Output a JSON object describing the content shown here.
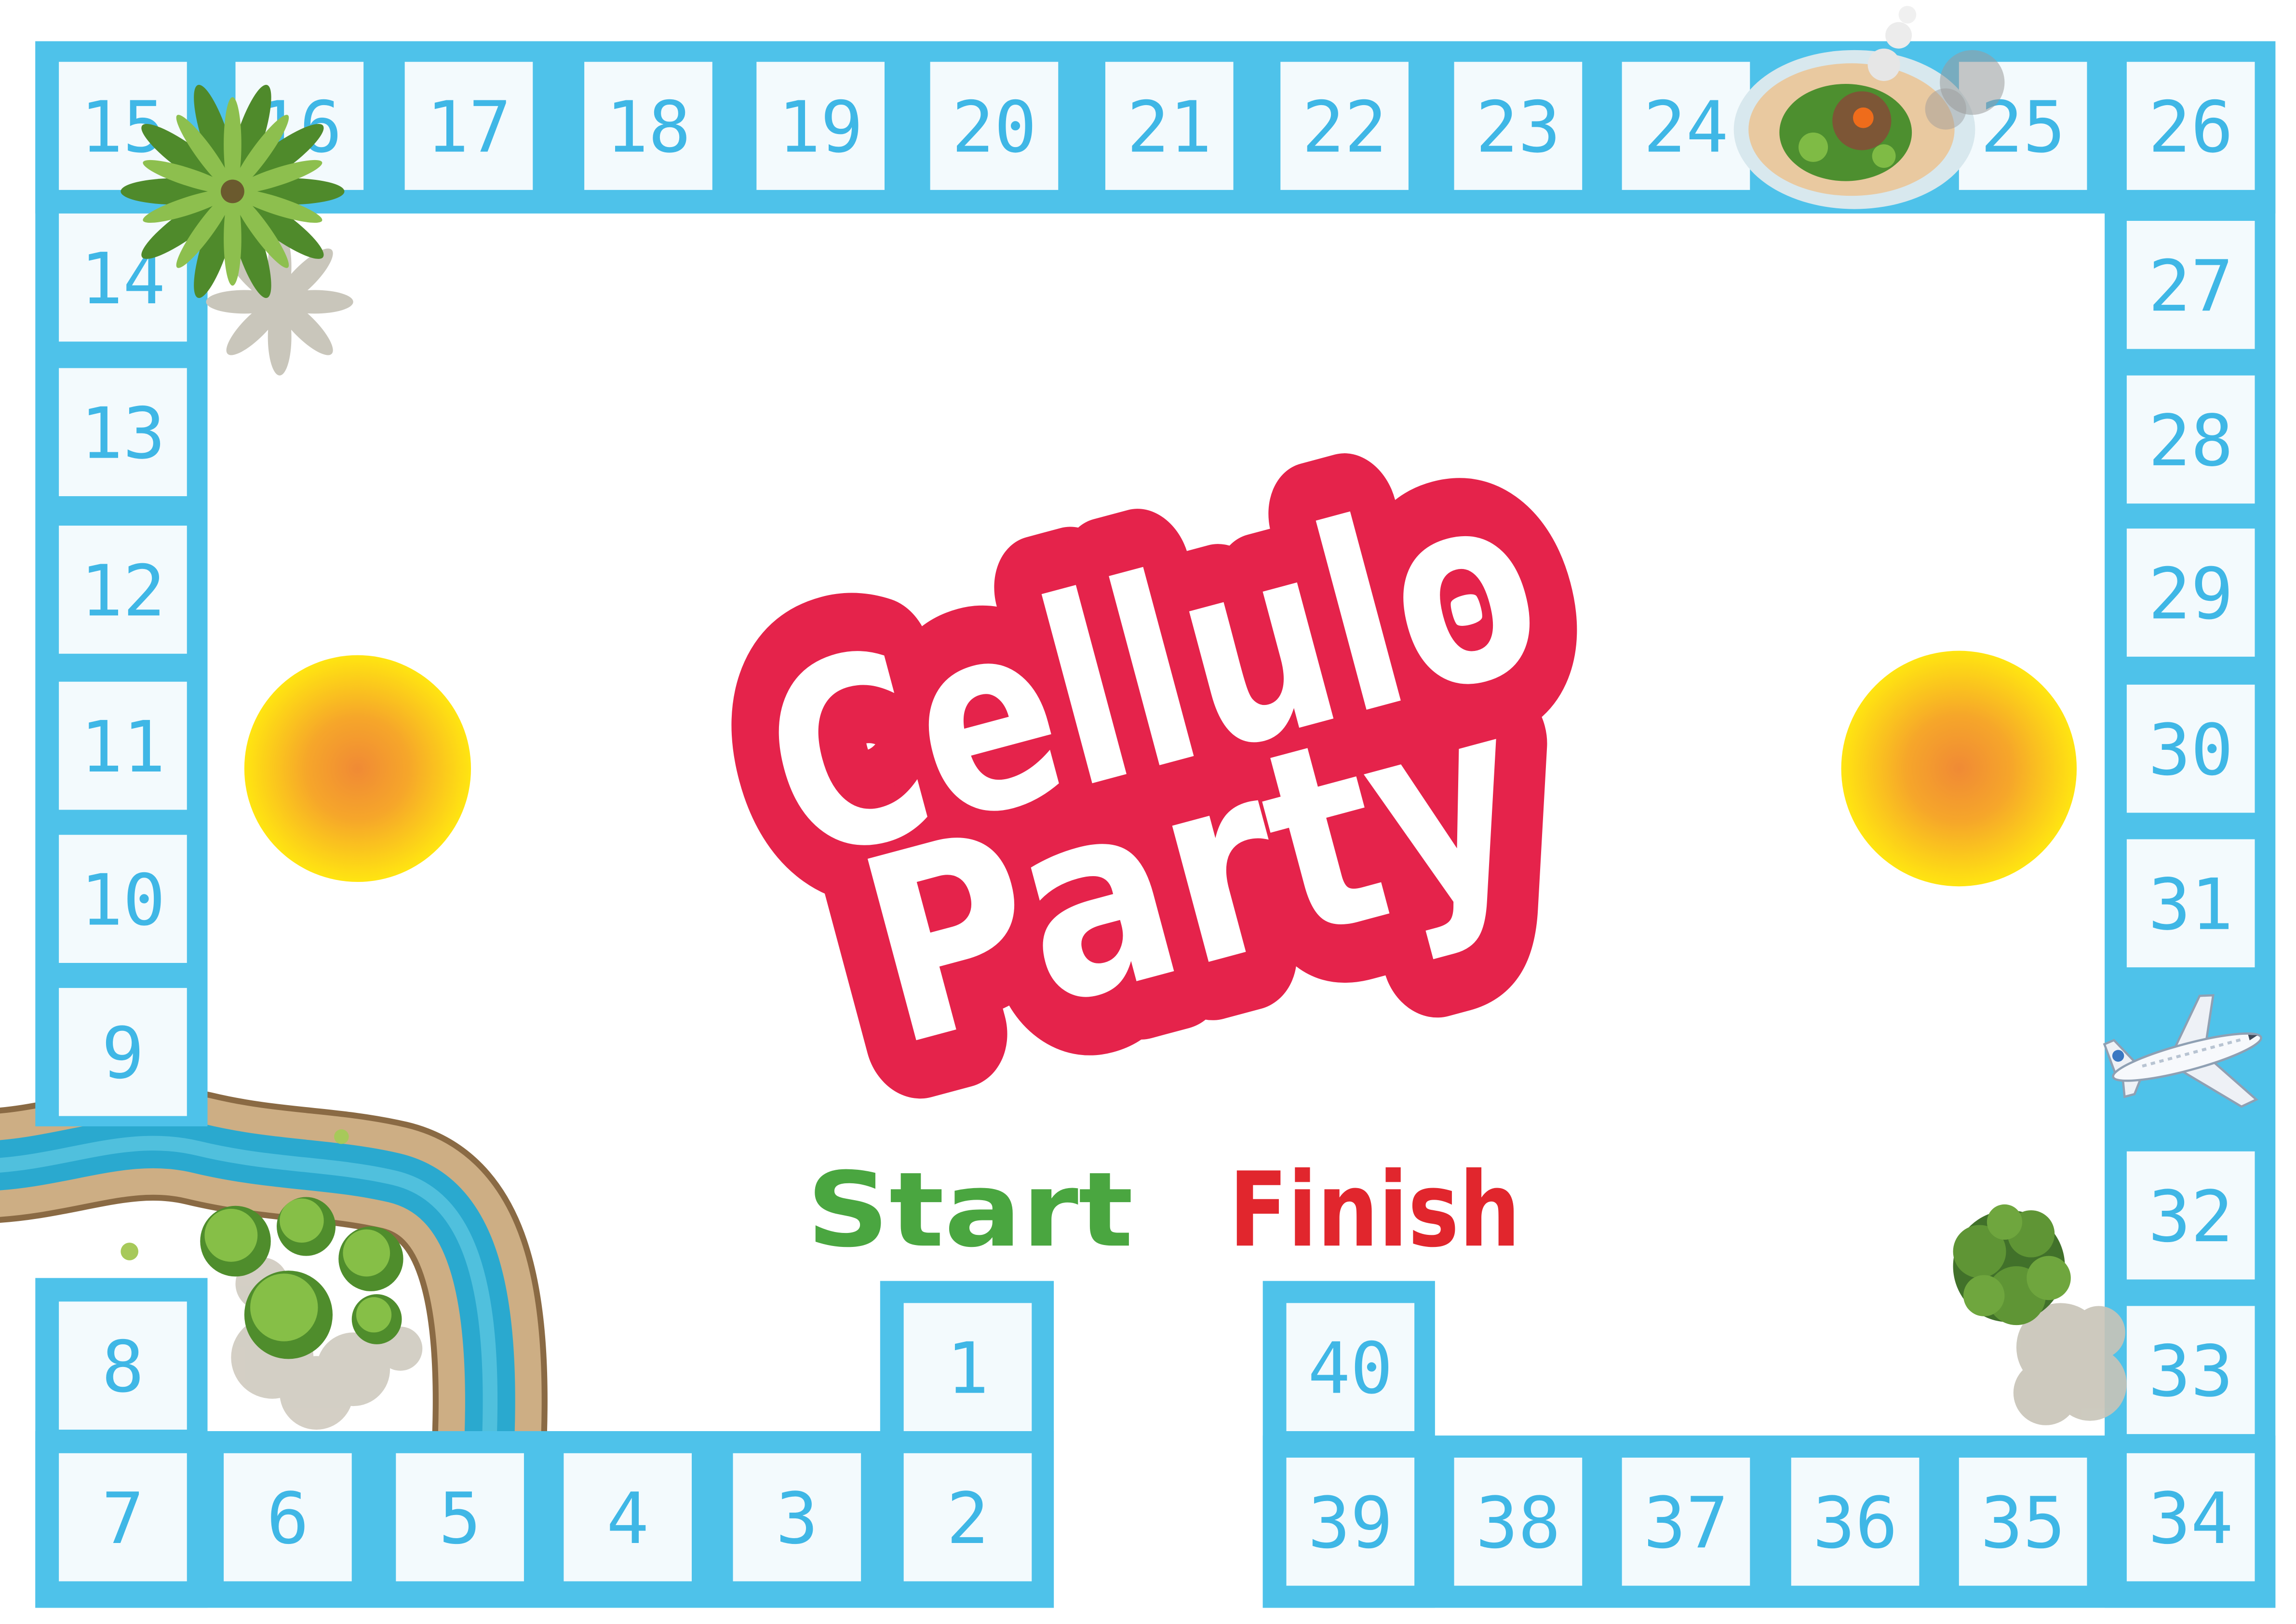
{
  "title": {
    "line1": "Cellulo",
    "line2": "Party"
  },
  "labels": {
    "start": "Start",
    "finish": "Finish"
  },
  "cells": [
    "1",
    "2",
    "3",
    "4",
    "5",
    "6",
    "7",
    "8",
    "9",
    "10",
    "11",
    "12",
    "13",
    "14",
    "15",
    "16",
    "17",
    "18",
    "19",
    "20",
    "21",
    "22",
    "23",
    "24",
    "25",
    "26",
    "27",
    "28",
    "29",
    "30",
    "31",
    "32",
    "33",
    "34",
    "35",
    "36",
    "37",
    "38",
    "39",
    "40"
  ],
  "colors": {
    "frame": "#4ec2ea",
    "cell_bg": "#f3fafd",
    "number": "#3fb7e6",
    "logo_red": "#e5234b",
    "logo_white": "#ffffff",
    "start_green": "#4aa640",
    "finish_red": "#e1262d",
    "sun_core": "#f08a35",
    "sun_mid": "#f6a62a",
    "sun_edge": "#ffe511"
  },
  "icons": [
    "sun-icon",
    "river-icon",
    "tree-cluster-icon",
    "palm-tree-icon",
    "volcano-island-icon",
    "airplane-icon",
    "bush-icon"
  ]
}
